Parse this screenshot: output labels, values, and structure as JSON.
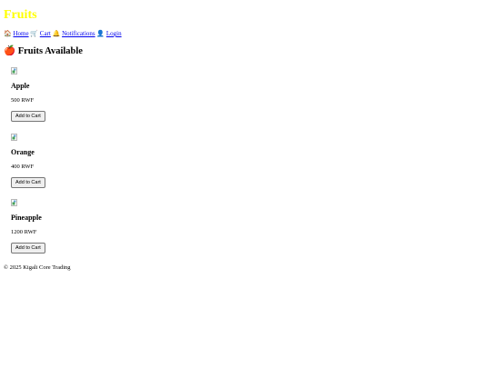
{
  "header": {
    "title": "Fruits"
  },
  "nav": {
    "items": [
      {
        "icon": "🏠",
        "icon_name": "home-icon",
        "label": "Home"
      },
      {
        "icon": "🛒",
        "icon_name": "cart-icon",
        "label": "Cart"
      },
      {
        "icon": "🔔",
        "icon_name": "bell-icon",
        "label": "Notifications"
      },
      {
        "icon": "👤",
        "icon_name": "user-icon",
        "label": "Login"
      }
    ]
  },
  "main": {
    "section_icon": "🍎",
    "section_icon_name": "apple-icon",
    "section_title": "Fruits Available",
    "products": [
      {
        "name": "Apple",
        "price": "500 RWF",
        "button_label": "Add to Cart"
      },
      {
        "name": "Orange",
        "price": "400 RWF",
        "button_label": "Add to Cart"
      },
      {
        "name": "Pineapple",
        "price": "1200 RWF",
        "button_label": "Add to Cart"
      }
    ]
  },
  "footer": {
    "text": "© 2025 Kigali Core Trading"
  },
  "colors": {
    "title": "#ffff00",
    "link": "#0000ee"
  }
}
